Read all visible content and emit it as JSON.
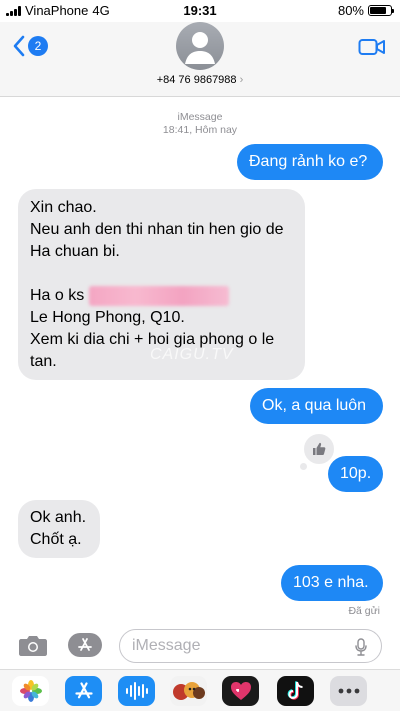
{
  "status_bar": {
    "carrier": "VinaPhone",
    "network": "4G",
    "time": "19:31",
    "battery": "80%",
    "battery_level": 0.8
  },
  "header": {
    "back_badge": "2",
    "contact": "+84 76 9867988",
    "chevron": "›"
  },
  "conversation": {
    "service": "iMessage",
    "timestamp": "18:41, Hôm nay",
    "messages": [
      {
        "from": "me",
        "text": "Đang rảnh ko e?"
      },
      {
        "from": "them",
        "text_lines": [
          "Xin chao.",
          "Neu anh den thi nhan tin hen gio de Ha chuan bi.",
          "",
          "Ha o ks",
          "Le Hong Phong, Q10.",
          "Xem ki dia chi + hoi gia phong o le tan."
        ]
      },
      {
        "from": "me",
        "text": "Ok, a qua luôn"
      },
      {
        "from": "me",
        "text": "10p."
      },
      {
        "from": "them",
        "text": "Ok anh.\nChốt ạ."
      },
      {
        "from": "me",
        "text": "103 e nha."
      }
    ],
    "watermark": "CAIGU.TV",
    "tapback": "thumbs-up-icon",
    "delivered": "Đã gửi"
  },
  "input": {
    "placeholder": "iMessage",
    "value": ""
  },
  "app_drawer": {
    "apps": [
      "photos-icon",
      "app-store-icon",
      "audio-icon",
      "memoji-icon",
      "heart-sticker-icon",
      "tiktok-icon",
      "more-icon"
    ]
  },
  "colors": {
    "outgoing": "#1e88f5",
    "incoming": "#e9e9eb",
    "accent": "#1e7cf2"
  }
}
